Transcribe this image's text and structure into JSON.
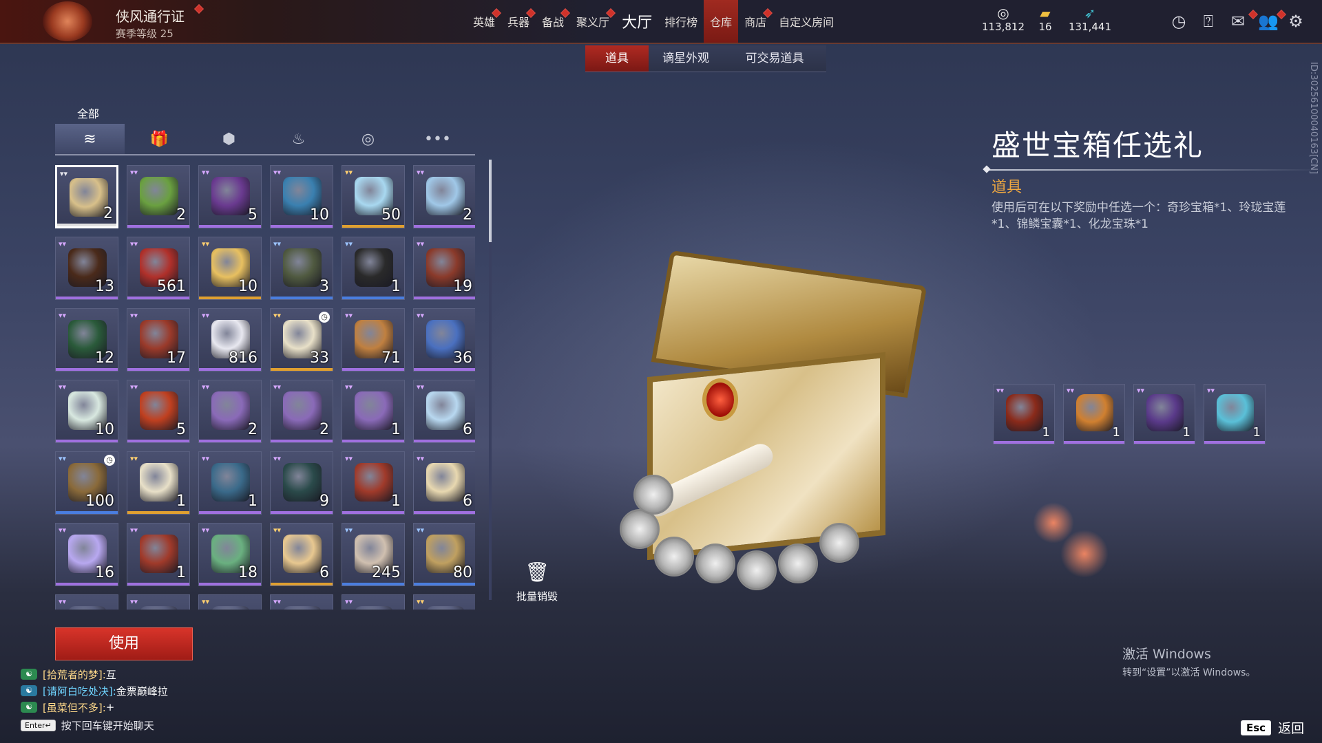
{
  "topbar": {
    "pass_title": "侠风通行证",
    "season_level": "赛季等级 25",
    "nav": [
      {
        "label": "英雄",
        "dot": true
      },
      {
        "label": "兵器",
        "dot": true
      },
      {
        "label": "备战",
        "dot": true
      },
      {
        "label": "聚义厅",
        "dot": true
      },
      {
        "label": "大厅",
        "big": true
      },
      {
        "label": "排行榜"
      },
      {
        "label": "仓库",
        "active": true
      },
      {
        "label": "商店",
        "dot": true
      },
      {
        "label": "自定义房间"
      }
    ],
    "currencies": [
      {
        "icon": "coin-stack-icon",
        "value": "113,812"
      },
      {
        "icon": "ticket-icon",
        "value": "16"
      },
      {
        "icon": "feather-icon",
        "value": "131,441"
      }
    ],
    "right_icons": [
      "timer-icon",
      "help-icon",
      "mail-icon",
      "friends-icon",
      "settings-icon"
    ]
  },
  "subtabs": [
    "道具",
    "谪星外观",
    "可交易道具"
  ],
  "category": {
    "label": "全部",
    "icons": [
      "layers-icon",
      "gift-icon",
      "token-icon",
      "flame-icon",
      "swirl-icon",
      "more-icon"
    ]
  },
  "items": [
    {
      "rarity": "white",
      "qty": "2",
      "color": "#d8c08a",
      "selected": true
    },
    {
      "rarity": "purple",
      "qty": "2",
      "color": "#6aa040"
    },
    {
      "rarity": "purple",
      "qty": "5",
      "color": "#6a3a90"
    },
    {
      "rarity": "purple",
      "qty": "10",
      "color": "#3a80b0"
    },
    {
      "rarity": "gold",
      "qty": "50",
      "color": "#a8d8f0"
    },
    {
      "rarity": "purple",
      "qty": "2",
      "color": "#a0c8e8"
    },
    {
      "rarity": "purple",
      "qty": "13",
      "color": "#4a2a1a"
    },
    {
      "rarity": "purple",
      "qty": "561",
      "color": "#b0302a"
    },
    {
      "rarity": "gold",
      "qty": "10",
      "color": "#e8c060"
    },
    {
      "rarity": "blue",
      "qty": "3",
      "color": "#505a40"
    },
    {
      "rarity": "blue",
      "qty": "1",
      "color": "#2a2a2a"
    },
    {
      "rarity": "purple",
      "qty": "19",
      "color": "#8a3a2a"
    },
    {
      "rarity": "purple",
      "qty": "12",
      "color": "#2a5a3a"
    },
    {
      "rarity": "purple",
      "qty": "17",
      "color": "#9a3a2a"
    },
    {
      "rarity": "purple",
      "qty": "816",
      "color": "#e8e8f0"
    },
    {
      "rarity": "gold",
      "qty": "33",
      "color": "#e8e0c8",
      "clock": true
    },
    {
      "rarity": "purple",
      "qty": "71",
      "color": "#c08040"
    },
    {
      "rarity": "purple",
      "qty": "36",
      "color": "#4a70c0"
    },
    {
      "rarity": "purple",
      "qty": "10",
      "color": "#d8e8e0"
    },
    {
      "rarity": "purple",
      "qty": "5",
      "color": "#c04020"
    },
    {
      "rarity": "purple",
      "qty": "2",
      "color": "#8a6ab8"
    },
    {
      "rarity": "purple",
      "qty": "2",
      "color": "#8a6ab8"
    },
    {
      "rarity": "purple",
      "qty": "1",
      "color": "#8a6ab8"
    },
    {
      "rarity": "purple",
      "qty": "6",
      "color": "#b8d8f0"
    },
    {
      "rarity": "blue",
      "qty": "100",
      "color": "#8a6a3a",
      "clock": true
    },
    {
      "rarity": "gold",
      "qty": "1",
      "color": "#e8e0c8"
    },
    {
      "rarity": "purple",
      "qty": "1",
      "color": "#3a6a8a"
    },
    {
      "rarity": "purple",
      "qty": "9",
      "color": "#2a4a4a"
    },
    {
      "rarity": "purple",
      "qty": "1",
      "color": "#a03a2a"
    },
    {
      "rarity": "purple",
      "qty": "6",
      "color": "#e8d8b0"
    },
    {
      "rarity": "purple",
      "qty": "16",
      "color": "#b8a8f0"
    },
    {
      "rarity": "purple",
      "qty": "1",
      "color": "#a03a2a"
    },
    {
      "rarity": "purple",
      "qty": "18",
      "color": "#6ab080"
    },
    {
      "rarity": "gold",
      "qty": "6",
      "color": "#e8c890"
    },
    {
      "rarity": "blue",
      "qty": "245",
      "color": "#d0c0b0"
    },
    {
      "rarity": "blue",
      "qty": "80",
      "color": "#c0a060"
    },
    {
      "rarity": "purple",
      "qty": "",
      "color": "#5a6080"
    },
    {
      "rarity": "purple",
      "qty": "",
      "color": "#5a6080"
    },
    {
      "rarity": "gold",
      "qty": "",
      "color": "#5a6080"
    },
    {
      "rarity": "purple",
      "qty": "",
      "color": "#5a6080"
    },
    {
      "rarity": "purple",
      "qty": "",
      "color": "#5a6080"
    },
    {
      "rarity": "gold",
      "qty": "",
      "color": "#5a6080"
    }
  ],
  "use_button": "使用",
  "bulk_destroy": "批量销毁",
  "chat": [
    {
      "name": "[拾荒者的梦]:",
      "msg": "互",
      "alt": false
    },
    {
      "name": "[请阿白吃处决]:",
      "msg": "金票巅峰拉",
      "alt": true
    },
    {
      "name": "[虽菜但不多]:",
      "msg": "+",
      "alt": false
    }
  ],
  "chat_hint": {
    "key": "Enter↵",
    "text": "按下回车键开始聊天"
  },
  "detail": {
    "title": "盛世宝箱任选礼",
    "type": "道具",
    "description": "使用后可在以下奖励中任选一个：奇珍宝箱*1、玲珑宝莲*1、锦鳞宝囊*1、化龙宝珠*1",
    "rewards": [
      {
        "qty": "1",
        "color": "#8a2a1a"
      },
      {
        "qty": "1",
        "color": "#d08030"
      },
      {
        "qty": "1",
        "color": "#5a3a8a"
      },
      {
        "qty": "1",
        "color": "#5ac0d8"
      }
    ]
  },
  "side_id": "ID:30256100040163[CN]",
  "activate": {
    "line1": "激活 Windows",
    "line2": "转到“设置”以激活 Windows。"
  },
  "esc": {
    "key": "Esc",
    "label": "返回"
  }
}
